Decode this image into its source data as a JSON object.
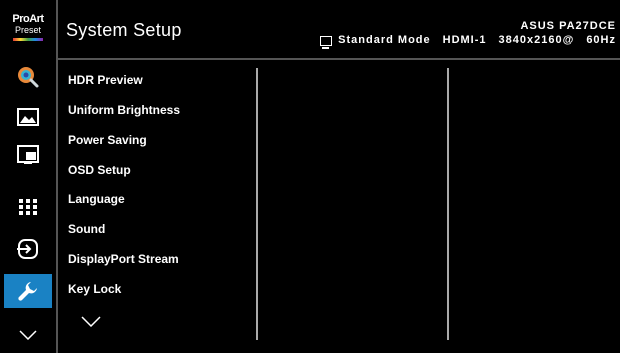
{
  "header": {
    "title": "System Setup",
    "model": "ASUS PA27DCE",
    "mode": "Standard Mode",
    "input": "HDMI-1",
    "resolution": "3840x2160@",
    "refresh": "60Hz"
  },
  "branding": {
    "line1": "ProArt",
    "line2": "Preset"
  },
  "sidebar": {
    "icons": [
      "palette-icon",
      "image-icon",
      "pip-icon",
      "grid-icon",
      "input-icon",
      "wrench-icon",
      "chevron-down-icon"
    ],
    "active": "wrench-icon",
    "accent_color": "#1a82c4"
  },
  "menu": {
    "items": [
      "HDR Preview",
      "Uniform Brightness",
      "Power Saving",
      "OSD Setup",
      "Language",
      "Sound",
      "DisplayPort Stream",
      "Key Lock"
    ]
  }
}
